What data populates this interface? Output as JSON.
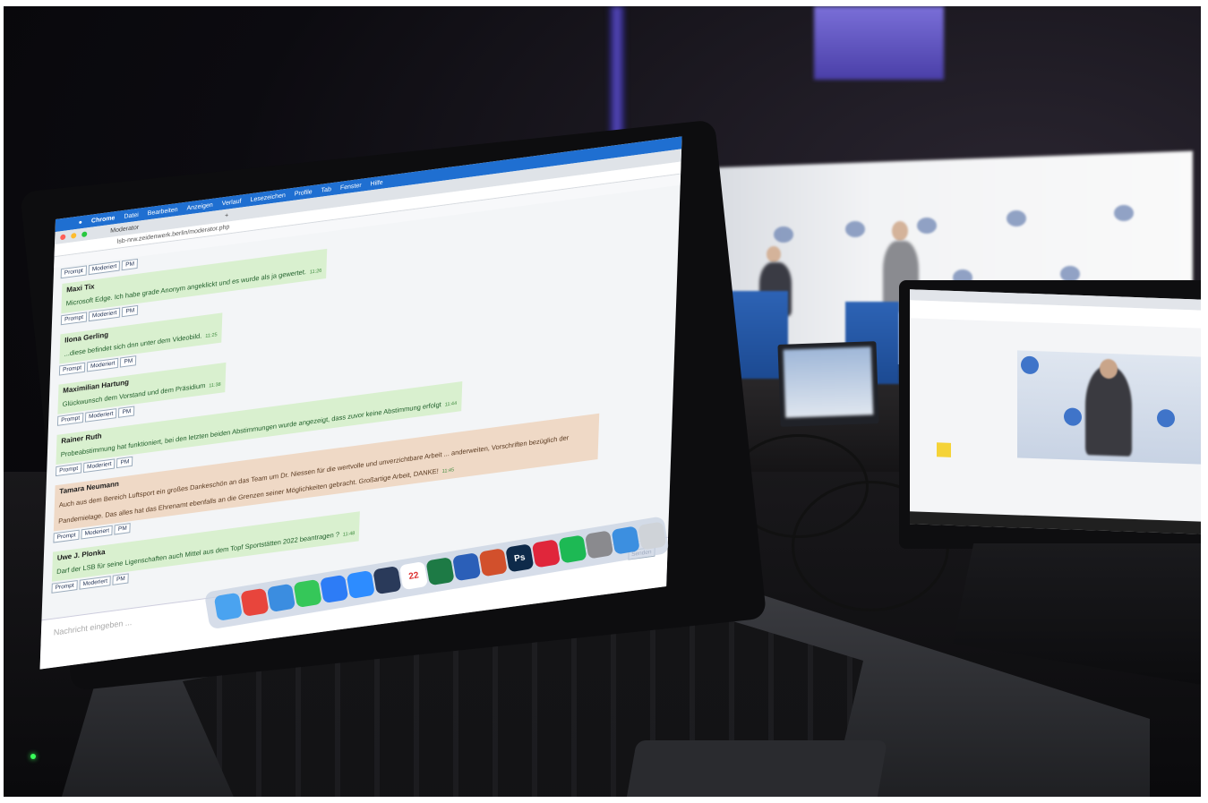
{
  "scene": {
    "description_hidden": ""
  },
  "browser": {
    "menu": [
      "Chrome",
      "Datei",
      "Bearbeiten",
      "Anzeigen",
      "Verlauf",
      "Lesezeichen",
      "Profile",
      "Tab",
      "Fenster",
      "Hilfe"
    ],
    "tab_title": "Moderator",
    "url": "lsb-nrw.zeidenwerk.berlin/moderator.php",
    "filter_buttons": [
      "Prompt",
      "Moderiert",
      "PM"
    ]
  },
  "chat": {
    "messages": [
      {
        "name": "Maxi Tix",
        "text": "Microsoft Edge. Ich habe grade Anonym angeklickt und es wurde als ja gewertet.",
        "time": "11:26",
        "style": "green"
      },
      {
        "name": "Ilona Gerling",
        "text": "...diese befindet sich dnn unter dem Videobild.",
        "time": "11:25",
        "style": "green"
      },
      {
        "name": "Maximilian Hartung",
        "text": "Glückwunsch dem Vorstand und dem Präsidium",
        "time": "11:38",
        "style": "green"
      },
      {
        "name": "Rainer Ruth",
        "text": "Probeabstimmung hat funktioniert, bei den letzten beiden Abstimmungen wurde angezeigt, dass zuvor keine Abstimmung erfolgt",
        "time": "11:44",
        "style": "green"
      },
      {
        "name": "Tamara Neumann",
        "text": "Auch aus dem Bereich Luftsport ein großes Dankeschön an das Team um Dr. Niessen für die wertvolle und unverzichtbare Arbeit ... anderweiten, Vorschriften bezüglich der Pandemielage. Das alles hat das Ehrenamt ebenfalls an die Grenzen seiner Möglichkeiten gebracht. Großartige Arbeit, DANKE!",
        "time": "11:45",
        "style": "tan"
      },
      {
        "name": "Uwe J. Plonka",
        "text": "Darf der LSB für seine Ligenschaften auch Mittel aus dem Topf Sportstätten 2022 beantragen ?",
        "time": "11:48",
        "style": "green"
      }
    ],
    "action_labels": [
      "Prompt",
      "Moderiert",
      "PM"
    ],
    "input_placeholder": "Nachricht eingeben ...",
    "send_label": "Senden"
  },
  "dock_icons": [
    {
      "name": "finder-icon",
      "color": "#4aa3f0"
    },
    {
      "name": "chrome-icon",
      "color": "#e8453c"
    },
    {
      "name": "safari-icon",
      "color": "#3b8de0"
    },
    {
      "name": "messages-icon",
      "color": "#35c759"
    },
    {
      "name": "app-store-icon",
      "color": "#2d7cf6"
    },
    {
      "name": "zoom-icon",
      "color": "#2d8cff"
    },
    {
      "name": "davinci-icon",
      "color": "#2a3a5a"
    },
    {
      "name": "calendar-icon",
      "color": "#ffffff",
      "label": "22"
    },
    {
      "name": "excel-icon",
      "color": "#1d7a45"
    },
    {
      "name": "word-icon",
      "color": "#2b5fb8"
    },
    {
      "name": "powerpoint-icon",
      "color": "#d2502c"
    },
    {
      "name": "photoshop-icon",
      "color": "#0e2a4a",
      "label": "Ps"
    },
    {
      "name": "castr-icon",
      "color": "#e0263b"
    },
    {
      "name": "spotify-icon",
      "color": "#1db954"
    },
    {
      "name": "settings-icon",
      "color": "#8a8a8e"
    },
    {
      "name": "screenshot-icon",
      "color": "#3c8fe0"
    },
    {
      "name": "trash-icon",
      "color": "#cfd3d8"
    }
  ]
}
